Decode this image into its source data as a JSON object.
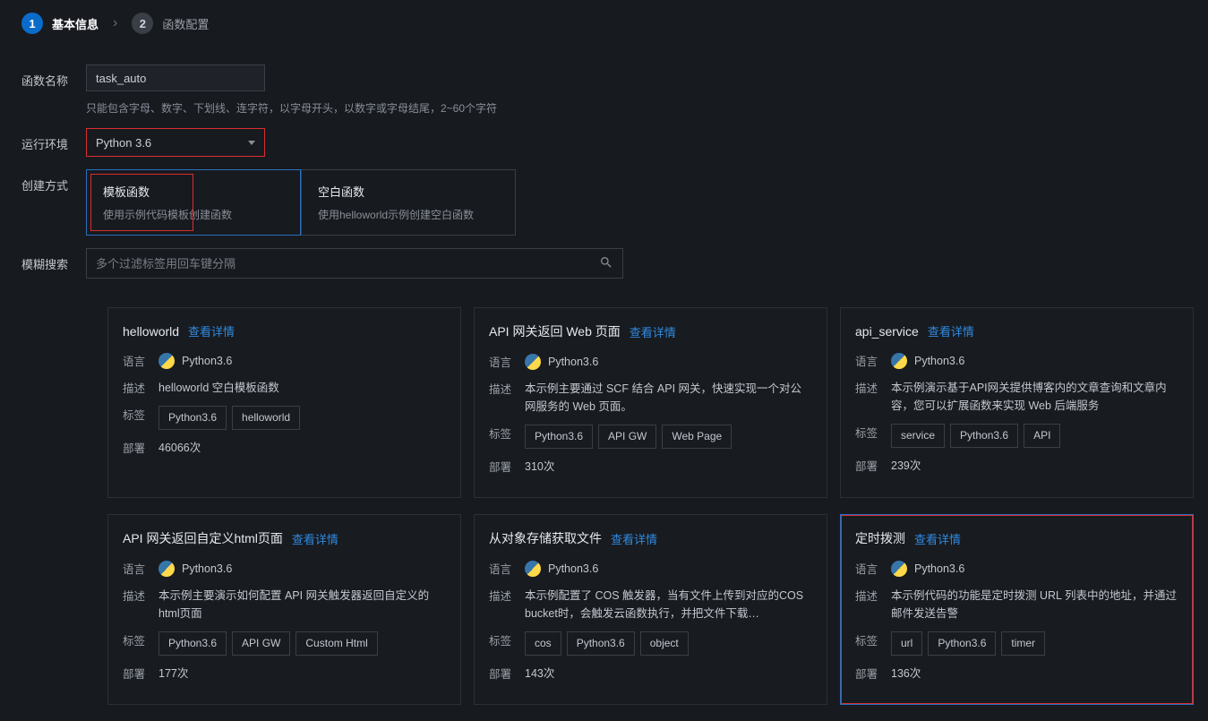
{
  "wizard": {
    "step1_num": "1",
    "step1_label": "基本信息",
    "step2_num": "2",
    "step2_label": "函数配置"
  },
  "form": {
    "name_label": "函数名称",
    "name_value": "task_auto",
    "name_hint": "只能包含字母、数字、下划线、连字符，以字母开头，以数字或字母结尾，2~60个字符",
    "runtime_label": "运行环境",
    "runtime_value": "Python 3.6",
    "method_label": "创建方式",
    "method_template_title": "模板函数",
    "method_template_sub": "使用示例代码模板创建函数",
    "method_blank_title": "空白函数",
    "method_blank_sub": "使用helloworld示例创建空白函数",
    "search_label": "模糊搜索",
    "search_placeholder": "多个过滤标签用回车键分隔"
  },
  "labels": {
    "lang": "语言",
    "desc": "描述",
    "tags": "标签",
    "deploy": "部署",
    "view": "查看详情"
  },
  "cards": [
    {
      "title": "helloworld",
      "lang": "Python3.6",
      "desc": "helloworld 空白模板函数",
      "tags": [
        "Python3.6",
        "helloworld"
      ],
      "deploy": "46066次",
      "selected": false
    },
    {
      "title": "API 网关返回 Web 页面",
      "lang": "Python3.6",
      "desc": "本示例主要通过 SCF 结合 API 网关，快速实现一个对公网服务的 Web 页面。",
      "tags": [
        "Python3.6",
        "API GW",
        "Web Page"
      ],
      "deploy": "310次",
      "selected": false
    },
    {
      "title": "api_service",
      "lang": "Python3.6",
      "desc": "本示例演示基于API网关提供博客内的文章查询和文章内容，您可以扩展函数来实现 Web 后端服务",
      "tags": [
        "service",
        "Python3.6",
        "API"
      ],
      "deploy": "239次",
      "selected": false
    },
    {
      "title": "API 网关返回自定义html页面",
      "lang": "Python3.6",
      "desc": "本示例主要演示如何配置 API 网关触发器返回自定义的html页面",
      "tags": [
        "Python3.6",
        "API GW",
        "Custom Html"
      ],
      "deploy": "177次",
      "selected": false
    },
    {
      "title": "从对象存储获取文件",
      "lang": "Python3.6",
      "desc": "本示例配置了 COS 触发器，当有文件上传到对应的COS bucket时，会触发云函数执行，并把文件下载…",
      "tags": [
        "cos",
        "Python3.6",
        "object"
      ],
      "deploy": "143次",
      "selected": false
    },
    {
      "title": "定时拨测",
      "lang": "Python3.6",
      "desc": "本示例代码的功能是定时拨测 URL 列表中的地址，并通过邮件发送告警",
      "tags": [
        "url",
        "Python3.6",
        "timer"
      ],
      "deploy": "136次",
      "selected": true
    }
  ]
}
